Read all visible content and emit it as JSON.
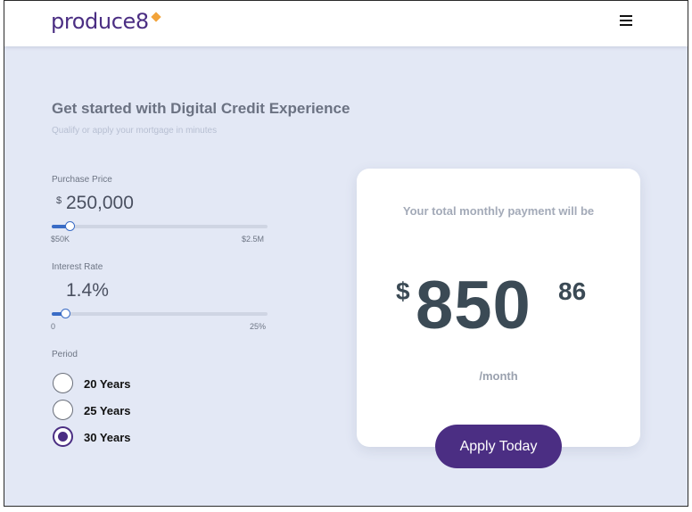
{
  "header": {
    "logo_text": "produce8",
    "logo_mark_color": "#f2a33a",
    "menu_icon": "hamburger-menu-icon"
  },
  "hero": {
    "title": "Get started with Digital Credit Experience",
    "subtitle": "Qualify or apply your mortgage in minutes"
  },
  "purchase_price": {
    "label": "Purchase Price",
    "currency_symbol": "$",
    "value": "250,000",
    "slider_min_label": "$50K",
    "slider_max_label": "$2.5M",
    "slider_fraction": 0.08
  },
  "interest_rate": {
    "label": "Interest Rate",
    "value": "1.4%",
    "slider_min_label": "0",
    "slider_max_label": "25%",
    "slider_fraction": 0.056
  },
  "period": {
    "label": "Period",
    "options": [
      {
        "label": "20 Years",
        "selected": false
      },
      {
        "label": "25 Years",
        "selected": false
      },
      {
        "label": "30 Years",
        "selected": true
      }
    ]
  },
  "payment_card": {
    "heading": "Your total monthly payment will be",
    "currency_symbol": "$",
    "amount_whole": "850",
    "amount_cents": "86",
    "period_suffix": "/month"
  },
  "cta": {
    "apply_label": "Apply Today"
  },
  "colors": {
    "brand": "#4b2e83",
    "accent": "#f2a33a",
    "slider": "#3a6cc6",
    "background": "#e3e8f5"
  }
}
